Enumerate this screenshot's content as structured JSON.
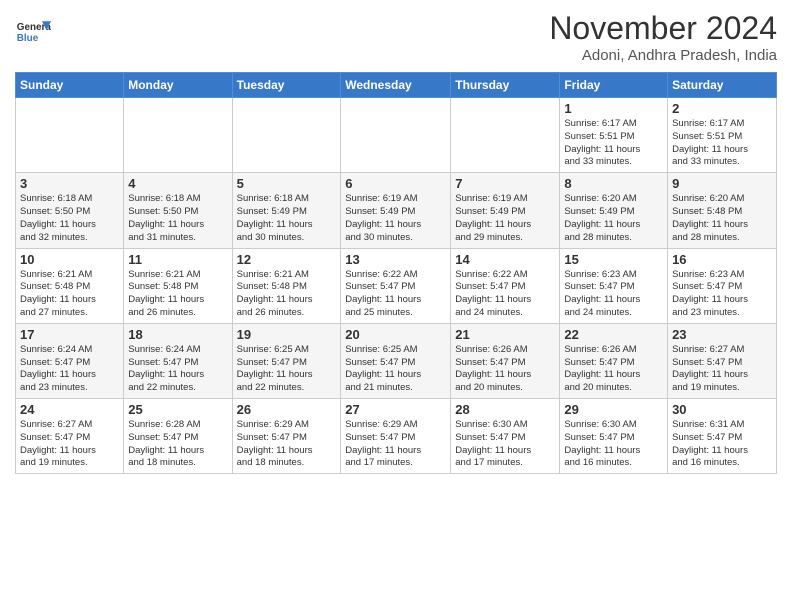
{
  "header": {
    "logo_line1": "General",
    "logo_line2": "Blue",
    "month_title": "November 2024",
    "location": "Adoni, Andhra Pradesh, India"
  },
  "weekdays": [
    "Sunday",
    "Monday",
    "Tuesday",
    "Wednesday",
    "Thursday",
    "Friday",
    "Saturday"
  ],
  "weeks": [
    [
      {
        "day": "",
        "info": ""
      },
      {
        "day": "",
        "info": ""
      },
      {
        "day": "",
        "info": ""
      },
      {
        "day": "",
        "info": ""
      },
      {
        "day": "",
        "info": ""
      },
      {
        "day": "1",
        "info": "Sunrise: 6:17 AM\nSunset: 5:51 PM\nDaylight: 11 hours\nand 33 minutes."
      },
      {
        "day": "2",
        "info": "Sunrise: 6:17 AM\nSunset: 5:51 PM\nDaylight: 11 hours\nand 33 minutes."
      }
    ],
    [
      {
        "day": "3",
        "info": "Sunrise: 6:18 AM\nSunset: 5:50 PM\nDaylight: 11 hours\nand 32 minutes."
      },
      {
        "day": "4",
        "info": "Sunrise: 6:18 AM\nSunset: 5:50 PM\nDaylight: 11 hours\nand 31 minutes."
      },
      {
        "day": "5",
        "info": "Sunrise: 6:18 AM\nSunset: 5:49 PM\nDaylight: 11 hours\nand 30 minutes."
      },
      {
        "day": "6",
        "info": "Sunrise: 6:19 AM\nSunset: 5:49 PM\nDaylight: 11 hours\nand 30 minutes."
      },
      {
        "day": "7",
        "info": "Sunrise: 6:19 AM\nSunset: 5:49 PM\nDaylight: 11 hours\nand 29 minutes."
      },
      {
        "day": "8",
        "info": "Sunrise: 6:20 AM\nSunset: 5:49 PM\nDaylight: 11 hours\nand 28 minutes."
      },
      {
        "day": "9",
        "info": "Sunrise: 6:20 AM\nSunset: 5:48 PM\nDaylight: 11 hours\nand 28 minutes."
      }
    ],
    [
      {
        "day": "10",
        "info": "Sunrise: 6:21 AM\nSunset: 5:48 PM\nDaylight: 11 hours\nand 27 minutes."
      },
      {
        "day": "11",
        "info": "Sunrise: 6:21 AM\nSunset: 5:48 PM\nDaylight: 11 hours\nand 26 minutes."
      },
      {
        "day": "12",
        "info": "Sunrise: 6:21 AM\nSunset: 5:48 PM\nDaylight: 11 hours\nand 26 minutes."
      },
      {
        "day": "13",
        "info": "Sunrise: 6:22 AM\nSunset: 5:47 PM\nDaylight: 11 hours\nand 25 minutes."
      },
      {
        "day": "14",
        "info": "Sunrise: 6:22 AM\nSunset: 5:47 PM\nDaylight: 11 hours\nand 24 minutes."
      },
      {
        "day": "15",
        "info": "Sunrise: 6:23 AM\nSunset: 5:47 PM\nDaylight: 11 hours\nand 24 minutes."
      },
      {
        "day": "16",
        "info": "Sunrise: 6:23 AM\nSunset: 5:47 PM\nDaylight: 11 hours\nand 23 minutes."
      }
    ],
    [
      {
        "day": "17",
        "info": "Sunrise: 6:24 AM\nSunset: 5:47 PM\nDaylight: 11 hours\nand 23 minutes."
      },
      {
        "day": "18",
        "info": "Sunrise: 6:24 AM\nSunset: 5:47 PM\nDaylight: 11 hours\nand 22 minutes."
      },
      {
        "day": "19",
        "info": "Sunrise: 6:25 AM\nSunset: 5:47 PM\nDaylight: 11 hours\nand 22 minutes."
      },
      {
        "day": "20",
        "info": "Sunrise: 6:25 AM\nSunset: 5:47 PM\nDaylight: 11 hours\nand 21 minutes."
      },
      {
        "day": "21",
        "info": "Sunrise: 6:26 AM\nSunset: 5:47 PM\nDaylight: 11 hours\nand 20 minutes."
      },
      {
        "day": "22",
        "info": "Sunrise: 6:26 AM\nSunset: 5:47 PM\nDaylight: 11 hours\nand 20 minutes."
      },
      {
        "day": "23",
        "info": "Sunrise: 6:27 AM\nSunset: 5:47 PM\nDaylight: 11 hours\nand 19 minutes."
      }
    ],
    [
      {
        "day": "24",
        "info": "Sunrise: 6:27 AM\nSunset: 5:47 PM\nDaylight: 11 hours\nand 19 minutes."
      },
      {
        "day": "25",
        "info": "Sunrise: 6:28 AM\nSunset: 5:47 PM\nDaylight: 11 hours\nand 18 minutes."
      },
      {
        "day": "26",
        "info": "Sunrise: 6:29 AM\nSunset: 5:47 PM\nDaylight: 11 hours\nand 18 minutes."
      },
      {
        "day": "27",
        "info": "Sunrise: 6:29 AM\nSunset: 5:47 PM\nDaylight: 11 hours\nand 17 minutes."
      },
      {
        "day": "28",
        "info": "Sunrise: 6:30 AM\nSunset: 5:47 PM\nDaylight: 11 hours\nand 17 minutes."
      },
      {
        "day": "29",
        "info": "Sunrise: 6:30 AM\nSunset: 5:47 PM\nDaylight: 11 hours\nand 16 minutes."
      },
      {
        "day": "30",
        "info": "Sunrise: 6:31 AM\nSunset: 5:47 PM\nDaylight: 11 hours\nand 16 minutes."
      }
    ]
  ]
}
